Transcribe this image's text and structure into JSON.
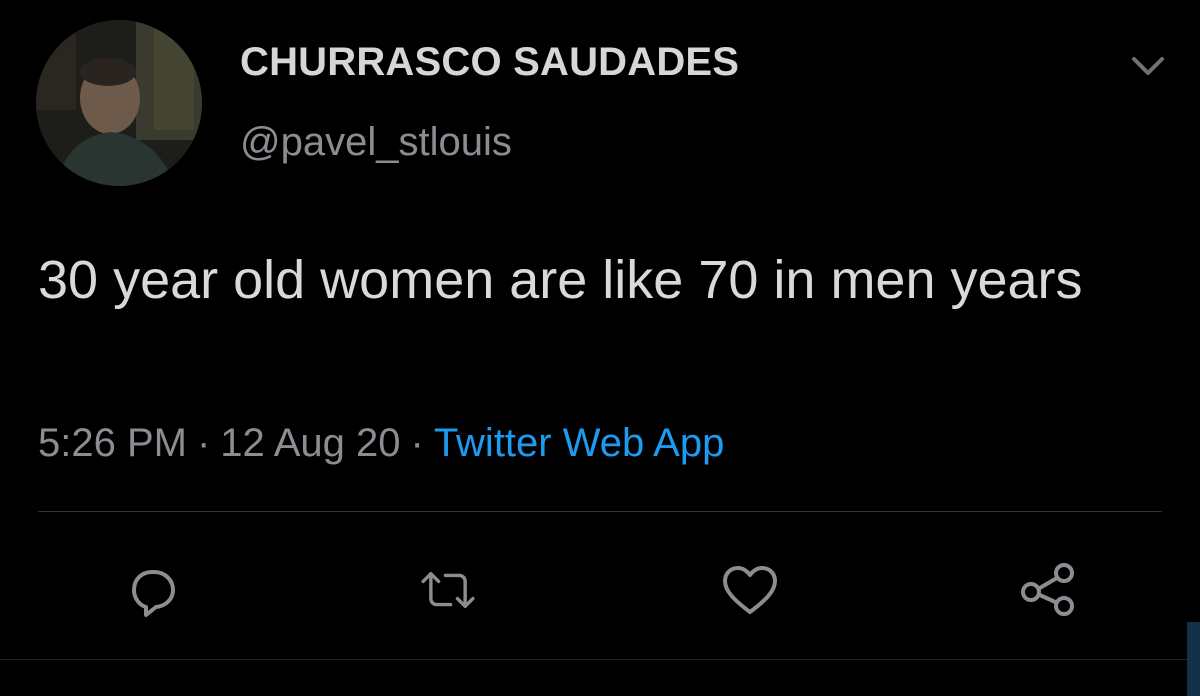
{
  "author": {
    "display_name": "CHURRASCO SAUDADES",
    "handle": "@pavel_stlouis",
    "avatar_icon": "profile-photo"
  },
  "tweet": {
    "text": "30 year old women are like 70 in men years",
    "time": "5:26 PM",
    "date": "12 Aug 20",
    "separator": "·",
    "source": "Twitter Web App"
  },
  "actions": [
    {
      "name": "reply",
      "icon": "speech-bubble-icon"
    },
    {
      "name": "retweet",
      "icon": "retweet-icon"
    },
    {
      "name": "like",
      "icon": "heart-icon"
    },
    {
      "name": "share",
      "icon": "share-icon"
    }
  ],
  "colors": {
    "background": "#000000",
    "text": "#d9d9d9",
    "secondary_text": "#8a8d91",
    "link": "#1d9bf0",
    "divider": "#2f3336",
    "icon": "#8a8d91"
  }
}
